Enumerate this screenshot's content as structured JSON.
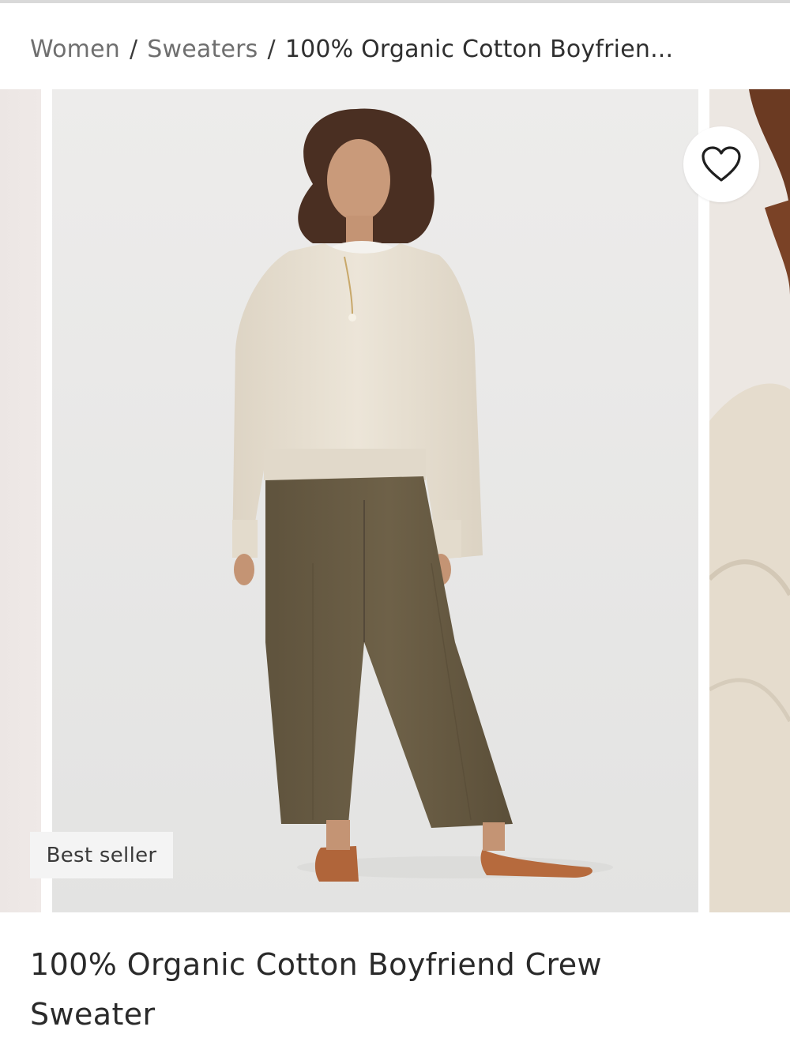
{
  "breadcrumb": {
    "items": [
      "Women",
      "Sweaters"
    ],
    "separator": "/",
    "current": "100% Organic Cotton Boyfrien..."
  },
  "product": {
    "title": "100% Organic Cotton Boyfriend Crew Sweater",
    "badge": "Best seller"
  },
  "icons": {
    "favorite": "heart-outline-icon"
  },
  "colors": {
    "sweater": "#e8e0d2",
    "trousers": "#6b5e45",
    "shoes": "#b86a3c",
    "background": "#e9e9e8"
  }
}
